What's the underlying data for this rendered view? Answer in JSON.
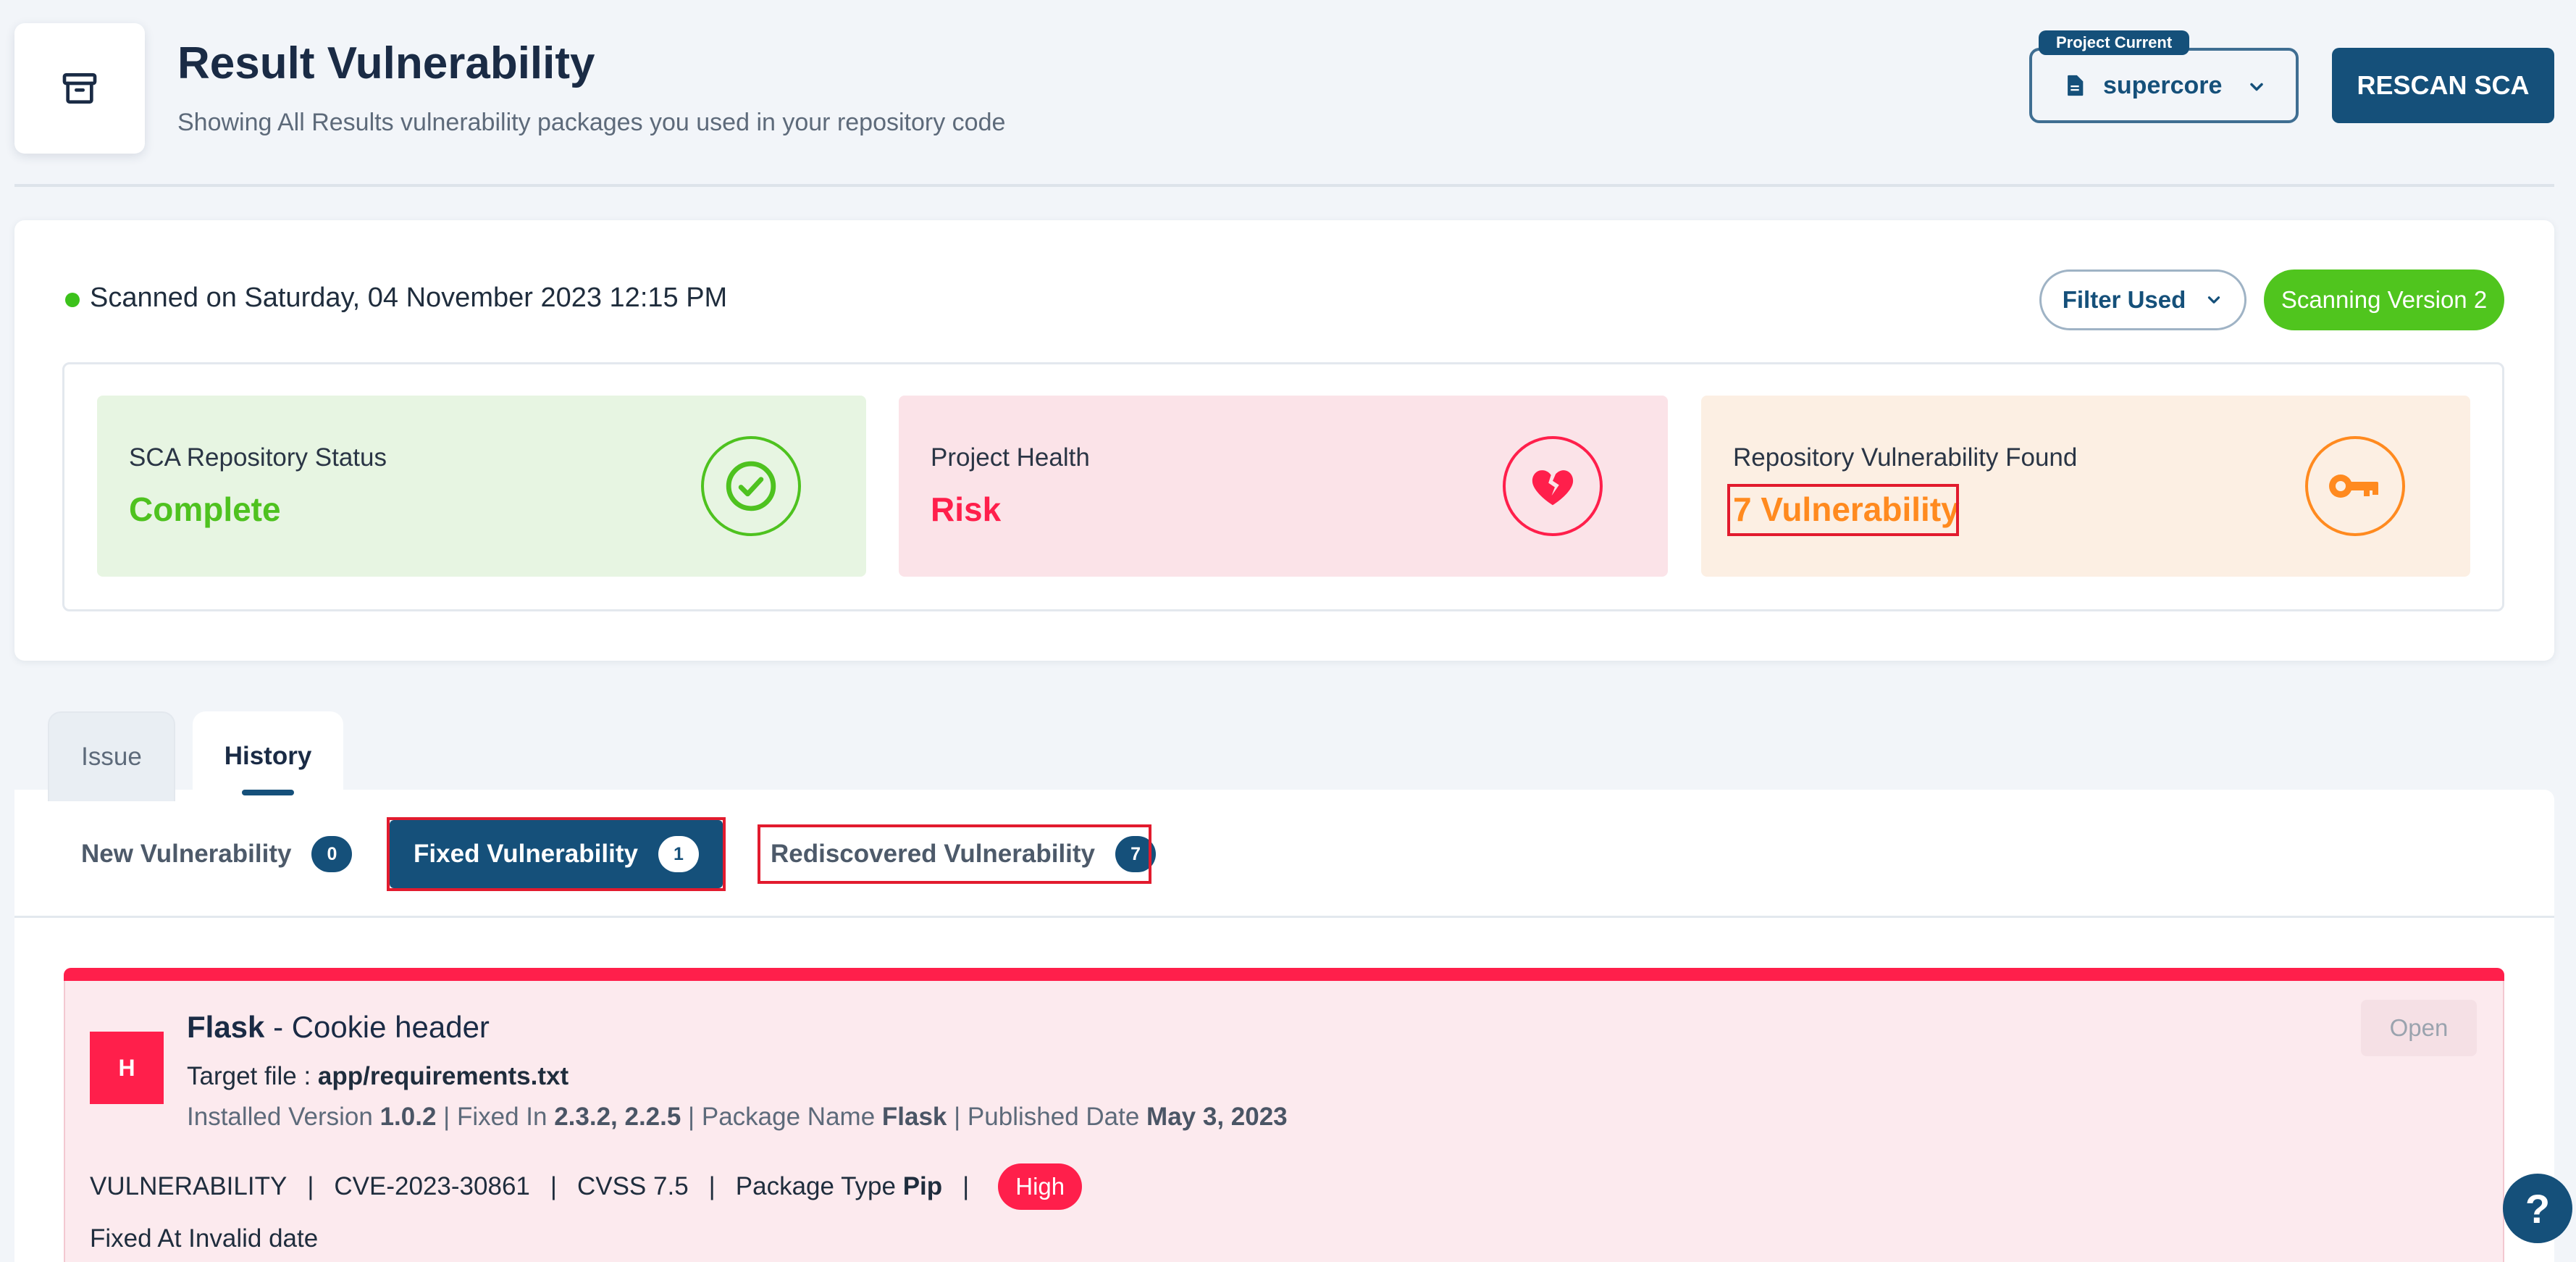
{
  "header": {
    "title": "Result Vulnerability",
    "subtitle": "Showing All Results vulnerability packages you used in your repository code",
    "project_tag": "Project Current",
    "project_name": "supercore",
    "rescan_label": "RESCAN SCA"
  },
  "scan": {
    "scanned_text": "Scanned on Saturday, 04 November 2023 12:15 PM",
    "filter_label": "Filter Used",
    "version_label": "Scanning Version 2"
  },
  "stats": [
    {
      "label": "SCA Repository Status",
      "value": "Complete",
      "color": "#4ec21f",
      "icon": "check-circle-icon"
    },
    {
      "label": "Project Health",
      "value": "Risk",
      "color": "#ff1f4b",
      "icon": "broken-heart-icon"
    },
    {
      "label": "Repository Vulnerability Found",
      "value": "7 Vulnerability",
      "color": "#ff8a1f",
      "icon": "key-icon"
    }
  ],
  "tabs": [
    {
      "label": "Issue",
      "active": false
    },
    {
      "label": "History",
      "active": true
    }
  ],
  "subtabs": [
    {
      "label": "New Vulnerability",
      "count": "0"
    },
    {
      "label": "Fixed Vulnerability",
      "count": "1",
      "active": true
    },
    {
      "label": "Rediscovered Vulnerability",
      "count": "7"
    }
  ],
  "vulnerability": {
    "severity_letter": "H",
    "package": "Flask",
    "title_rest": " - Cookie header",
    "target_label": "Target file : ",
    "target_file": "app/requirements.txt",
    "installed_label": "Installed Version ",
    "installed_version": "1.0.2",
    "fixed_in_label": " | Fixed In ",
    "fixed_in": "2.3.2, 2.2.5",
    "package_name_label": " | Package Name ",
    "package_name": "Flask",
    "published_label": " | Published Date ",
    "published_date": "May 3, 2023",
    "type": "VULNERABILITY",
    "cve": "CVE-2023-30861",
    "cvss": "CVSS 7.5",
    "package_type_label": "Package Type ",
    "package_type": "Pip",
    "severity": "High",
    "fixed_at": "Fixed At Invalid date",
    "open_label": "Open",
    "separator": "|"
  },
  "help_label": "?",
  "colors": {
    "primary": "#15507a",
    "success": "#4ec21f",
    "danger": "#ff1f4b",
    "warning": "#ff8a1f",
    "highlight": "#e21b2e"
  }
}
